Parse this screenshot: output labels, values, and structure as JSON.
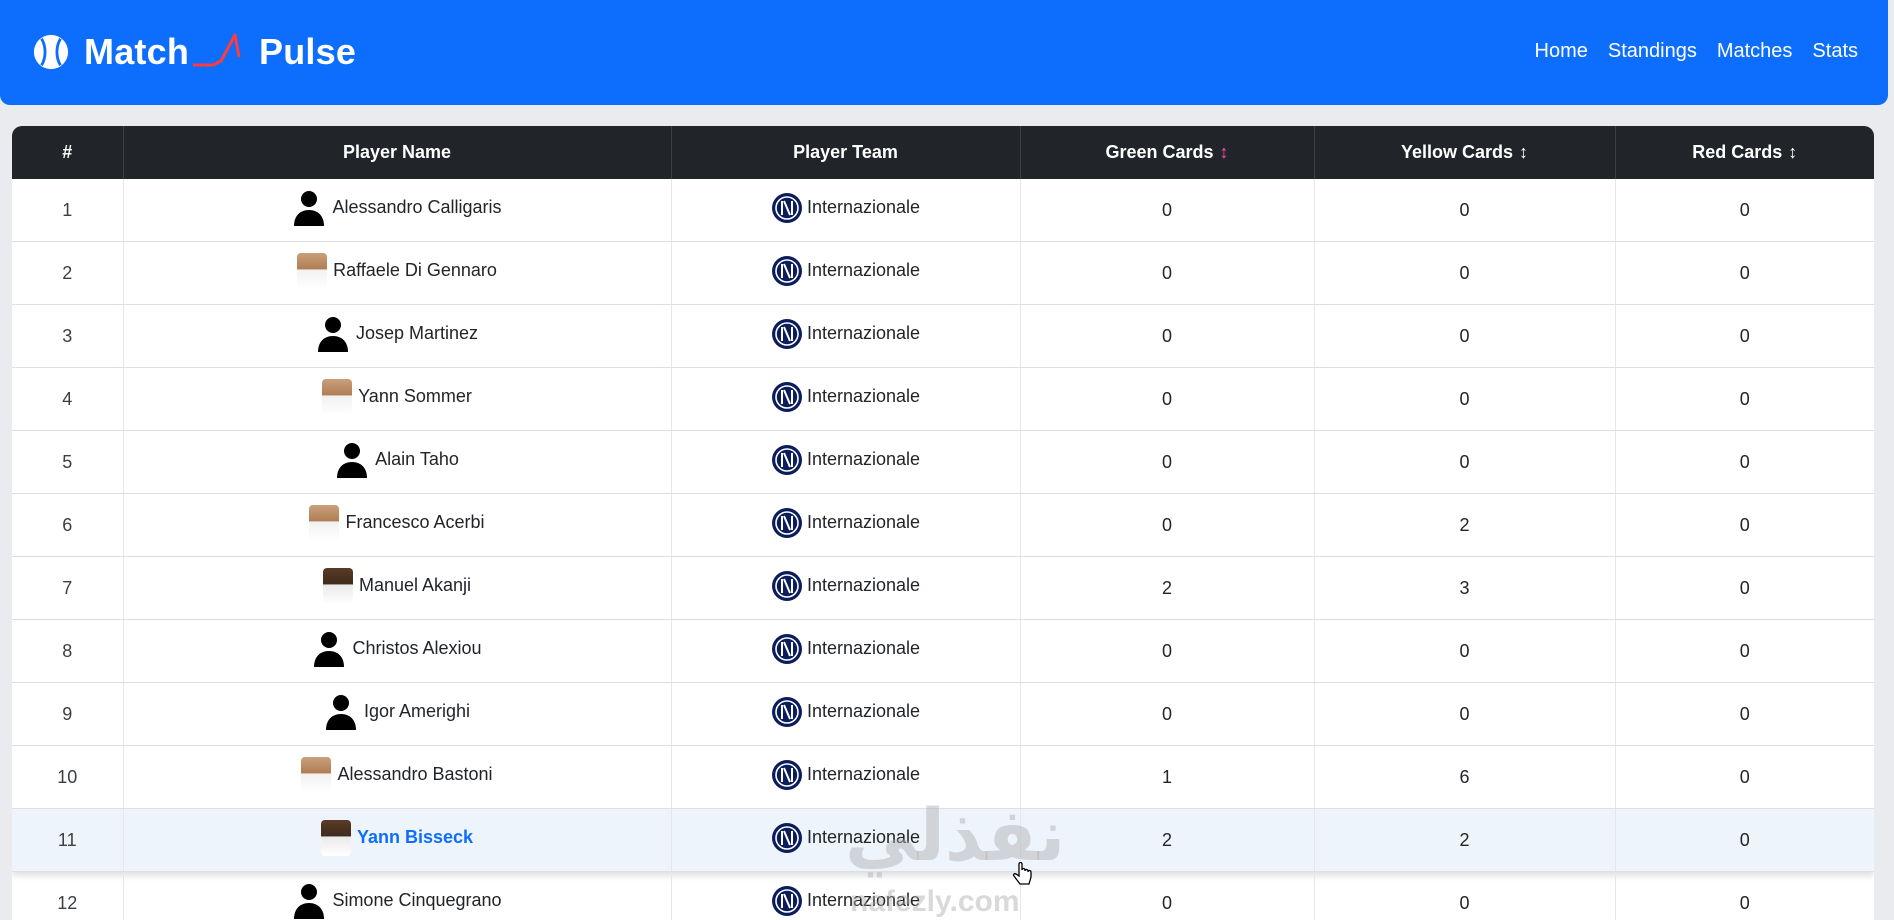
{
  "brand": {
    "word1": "Match",
    "word2": "Pulse",
    "icon": "baseball-icon",
    "accent_color": "#ff3b3b"
  },
  "nav": {
    "links": [
      "Home",
      "Standings",
      "Matches",
      "Stats"
    ]
  },
  "colors": {
    "navbar": "#0d6efd",
    "table_header": "#212529",
    "link": "#0d6efd"
  },
  "table": {
    "headers": [
      "#",
      "Player Name",
      "Player Team",
      "Green Cards",
      "Yellow Cards",
      "Red Cards"
    ],
    "sort_indicator": "↕",
    "rows": [
      {
        "index": "1",
        "name": "Alessandro Calligaris",
        "avatar": "silhouette",
        "team": "Internazionale",
        "green": "0",
        "yellow": "0",
        "red": "0"
      },
      {
        "index": "2",
        "name": "Raffaele Di Gennaro",
        "avatar": "photo",
        "team": "Internazionale",
        "green": "0",
        "yellow": "0",
        "red": "0"
      },
      {
        "index": "3",
        "name": "Josep Martinez",
        "avatar": "silhouette",
        "team": "Internazionale",
        "green": "0",
        "yellow": "0",
        "red": "0"
      },
      {
        "index": "4",
        "name": "Yann Sommer",
        "avatar": "photo",
        "team": "Internazionale",
        "green": "0",
        "yellow": "0",
        "red": "0"
      },
      {
        "index": "5",
        "name": "Alain Taho",
        "avatar": "silhouette",
        "team": "Internazionale",
        "green": "0",
        "yellow": "0",
        "red": "0"
      },
      {
        "index": "6",
        "name": "Francesco Acerbi",
        "avatar": "photo",
        "team": "Internazionale",
        "green": "0",
        "yellow": "2",
        "red": "0"
      },
      {
        "index": "7",
        "name": "Manuel Akanji",
        "avatar": "photo-dark",
        "team": "Internazionale",
        "green": "2",
        "yellow": "3",
        "red": "0"
      },
      {
        "index": "8",
        "name": "Christos Alexiou",
        "avatar": "silhouette",
        "team": "Internazionale",
        "green": "0",
        "yellow": "0",
        "red": "0"
      },
      {
        "index": "9",
        "name": "Igor Amerighi",
        "avatar": "silhouette",
        "team": "Internazionale",
        "green": "0",
        "yellow": "0",
        "red": "0"
      },
      {
        "index": "10",
        "name": "Alessandro Bastoni",
        "avatar": "photo",
        "team": "Internazionale",
        "green": "1",
        "yellow": "6",
        "red": "0"
      },
      {
        "index": "11",
        "name": "Yann Bisseck",
        "avatar": "photo-dark",
        "team": "Internazionale",
        "green": "2",
        "yellow": "2",
        "red": "0",
        "hovered": true
      },
      {
        "index": "12",
        "name": "Simone Cinquegrano",
        "avatar": "silhouette",
        "team": "Internazionale",
        "green": "0",
        "yellow": "0",
        "red": "0"
      }
    ]
  },
  "watermark": {
    "text": "نفذلي",
    "url": "nafezly.com"
  }
}
